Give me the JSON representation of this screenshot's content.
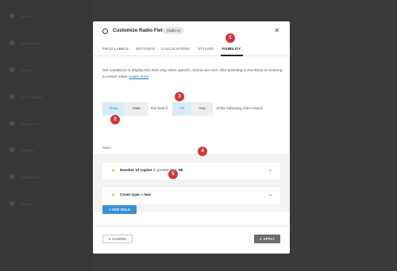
{
  "background": {
    "sidebar_items": [
      "Details",
      "Notifications",
      "Actions",
      "Form Settings",
      "Integrations",
      "Analytics",
      "Submissions",
      "Results"
    ]
  },
  "modal": {
    "title": "Customize Radio Field",
    "field_id": "(radio-2)",
    "close_glyph": "✕",
    "tabs": [
      {
        "label": "FIELD LABELS",
        "active": false
      },
      {
        "label": "SETTINGS",
        "active": false
      },
      {
        "label": "CALCULATIONS",
        "active": false
      },
      {
        "label": "STYLING",
        "active": false
      },
      {
        "label": "VISIBILITY",
        "active": true
      }
    ],
    "description": "Set conditions to display this field only when specific criteria are met—like selecting a checkbox or entering a certain value.",
    "learn_more": "Learn more",
    "condition": {
      "show_label": "Show",
      "hide_label": "Hide",
      "selected_action": "Show",
      "text_field_if": "this field if",
      "all_label": "All",
      "any_label": "Any",
      "selected_match": "All",
      "text_rules_match": "of the following rules match:"
    },
    "rules_label": "Rules",
    "rules": [
      {
        "field": "Number of copies",
        "operator": "is greater than",
        "value": "99"
      },
      {
        "field": "Cover type",
        "operator": "is",
        "value": "two"
      }
    ],
    "add_rule_label": "+ ADD RULE",
    "cancel_label": "✕ CANCEL",
    "apply_label": "✔ APPLY"
  },
  "callouts": [
    "1",
    "2",
    "3",
    "4",
    "5"
  ],
  "colors": {
    "overlay": "#3a3a3a",
    "accent": "#3b8fd6",
    "segment_selected_bg": "#d7ecf7",
    "callout": "#d23737",
    "apply": "#6b6b6b",
    "rule_icon": "#e1b84a"
  }
}
